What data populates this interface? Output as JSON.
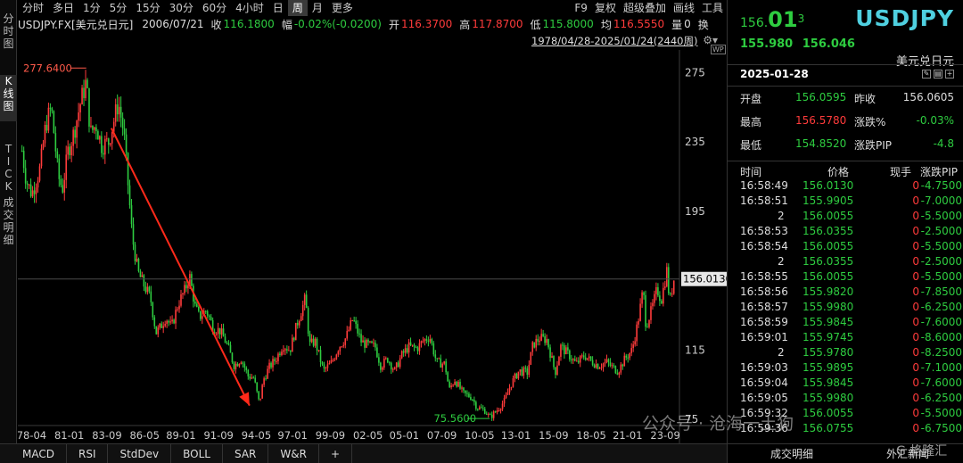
{
  "left_tabs": [
    "分\n时\n图",
    "K\n线\n图",
    "T\nI\nC\nK",
    "成\n交\n明\n细"
  ],
  "toolbar": {
    "periods": [
      "分时",
      "多日",
      "1分",
      "5分",
      "15分",
      "30分",
      "60分",
      "4小时",
      "日",
      "周",
      "月",
      "更多"
    ],
    "active_period": "周",
    "right": [
      "F9",
      "复权",
      "超级叠加",
      "画线",
      "工具"
    ]
  },
  "info": {
    "symbol_label": "USDJPY.FX[美元兑日元]",
    "date": "2006/07/21",
    "close_label": "收",
    "close": "116.1800",
    "range_label": "幅",
    "range": "-0.02%(-0.0200)",
    "open_label": "开",
    "open": "116.3700",
    "high_label": "高",
    "high": "117.8700",
    "low_label": "低",
    "low": "115.8000",
    "avg_label": "均",
    "avg": "116.5550",
    "vol_label": "量",
    "vol": "0",
    "switch_label": "换"
  },
  "range_selector": "1978/04/28-2025/01/24(2440周)",
  "chart_data": {
    "type": "candlestick",
    "title": "",
    "y_ticks": [
      275,
      235,
      195,
      155,
      115,
      75
    ],
    "ylim": [
      72,
      285
    ],
    "x_ticks": [
      "78-04",
      "81-01",
      "83-09",
      "86-05",
      "89-01",
      "91-09",
      "94-05",
      "97-01",
      "99-09",
      "02-05",
      "05-01",
      "07-09",
      "10-05",
      "13-01",
      "15-09",
      "18-05",
      "21-01",
      "23-09"
    ],
    "max_label": "277.6400",
    "min_label": "75.5600",
    "last_price_label": "156.0130",
    "close_path": [
      {
        "x": 1978.3,
        "y": 230
      },
      {
        "x": 1978.6,
        "y": 213
      },
      {
        "x": 1979.0,
        "y": 205
      },
      {
        "x": 1979.6,
        "y": 220
      },
      {
        "x": 1980.0,
        "y": 245
      },
      {
        "x": 1980.4,
        "y": 255
      },
      {
        "x": 1980.9,
        "y": 215
      },
      {
        "x": 1981.2,
        "y": 208
      },
      {
        "x": 1981.6,
        "y": 230
      },
      {
        "x": 1982.0,
        "y": 240
      },
      {
        "x": 1982.5,
        "y": 258
      },
      {
        "x": 1982.9,
        "y": 270
      },
      {
        "x": 1983.2,
        "y": 240
      },
      {
        "x": 1983.6,
        "y": 245
      },
      {
        "x": 1984.0,
        "y": 233
      },
      {
        "x": 1984.5,
        "y": 235
      },
      {
        "x": 1984.9,
        "y": 248
      },
      {
        "x": 1985.2,
        "y": 258
      },
      {
        "x": 1985.6,
        "y": 240
      },
      {
        "x": 1985.9,
        "y": 210
      },
      {
        "x": 1986.2,
        "y": 180
      },
      {
        "x": 1986.6,
        "y": 160
      },
      {
        "x": 1987.0,
        "y": 153
      },
      {
        "x": 1987.5,
        "y": 145
      },
      {
        "x": 1987.9,
        "y": 125
      },
      {
        "x": 1988.2,
        "y": 128
      },
      {
        "x": 1988.6,
        "y": 134
      },
      {
        "x": 1989.0,
        "y": 128
      },
      {
        "x": 1989.5,
        "y": 142
      },
      {
        "x": 1990.0,
        "y": 150
      },
      {
        "x": 1990.3,
        "y": 158
      },
      {
        "x": 1990.7,
        "y": 140
      },
      {
        "x": 1991.0,
        "y": 134
      },
      {
        "x": 1991.5,
        "y": 138
      },
      {
        "x": 1992.0,
        "y": 128
      },
      {
        "x": 1992.5,
        "y": 126
      },
      {
        "x": 1993.0,
        "y": 118
      },
      {
        "x": 1993.5,
        "y": 106
      },
      {
        "x": 1994.0,
        "y": 110
      },
      {
        "x": 1994.5,
        "y": 100
      },
      {
        "x": 1994.9,
        "y": 99
      },
      {
        "x": 1995.3,
        "y": 84
      },
      {
        "x": 1995.6,
        "y": 98
      },
      {
        "x": 1996.0,
        "y": 105
      },
      {
        "x": 1996.5,
        "y": 110
      },
      {
        "x": 1997.0,
        "y": 118
      },
      {
        "x": 1997.5,
        "y": 115
      },
      {
        "x": 1998.0,
        "y": 130
      },
      {
        "x": 1998.6,
        "y": 145
      },
      {
        "x": 1998.9,
        "y": 118
      },
      {
        "x": 1999.3,
        "y": 120
      },
      {
        "x": 1999.9,
        "y": 103
      },
      {
        "x": 2000.5,
        "y": 108
      },
      {
        "x": 2001.0,
        "y": 117
      },
      {
        "x": 2001.5,
        "y": 122
      },
      {
        "x": 2002.0,
        "y": 133
      },
      {
        "x": 2002.6,
        "y": 120
      },
      {
        "x": 2003.0,
        "y": 118
      },
      {
        "x": 2003.6,
        "y": 117
      },
      {
        "x": 2004.0,
        "y": 106
      },
      {
        "x": 2004.5,
        "y": 110
      },
      {
        "x": 2005.0,
        "y": 103
      },
      {
        "x": 2005.5,
        "y": 112
      },
      {
        "x": 2006.0,
        "y": 117
      },
      {
        "x": 2006.6,
        "y": 116
      },
      {
        "x": 2007.0,
        "y": 120
      },
      {
        "x": 2007.5,
        "y": 123
      },
      {
        "x": 2008.0,
        "y": 108
      },
      {
        "x": 2008.6,
        "y": 107
      },
      {
        "x": 2008.9,
        "y": 92
      },
      {
        "x": 2009.3,
        "y": 98
      },
      {
        "x": 2009.9,
        "y": 90
      },
      {
        "x": 2010.5,
        "y": 88
      },
      {
        "x": 2010.9,
        "y": 82
      },
      {
        "x": 2011.5,
        "y": 80
      },
      {
        "x": 2011.8,
        "y": 76
      },
      {
        "x": 2012.3,
        "y": 80
      },
      {
        "x": 2012.9,
        "y": 86
      },
      {
        "x": 2013.3,
        "y": 95
      },
      {
        "x": 2013.9,
        "y": 103
      },
      {
        "x": 2014.5,
        "y": 102
      },
      {
        "x": 2014.9,
        "y": 118
      },
      {
        "x": 2015.4,
        "y": 122
      },
      {
        "x": 2015.9,
        "y": 121
      },
      {
        "x": 2016.5,
        "y": 102
      },
      {
        "x": 2016.9,
        "y": 117
      },
      {
        "x": 2017.5,
        "y": 112
      },
      {
        "x": 2018.0,
        "y": 107
      },
      {
        "x": 2018.6,
        "y": 112
      },
      {
        "x": 2019.0,
        "y": 109
      },
      {
        "x": 2019.6,
        "y": 106
      },
      {
        "x": 2020.2,
        "y": 108
      },
      {
        "x": 2020.6,
        "y": 105
      },
      {
        "x": 2021.0,
        "y": 103
      },
      {
        "x": 2021.5,
        "y": 110
      },
      {
        "x": 2022.0,
        "y": 115
      },
      {
        "x": 2022.4,
        "y": 130
      },
      {
        "x": 2022.8,
        "y": 150
      },
      {
        "x": 2023.0,
        "y": 129
      },
      {
        "x": 2023.4,
        "y": 138
      },
      {
        "x": 2023.8,
        "y": 150
      },
      {
        "x": 2024.1,
        "y": 144
      },
      {
        "x": 2024.5,
        "y": 161
      },
      {
        "x": 2024.7,
        "y": 142
      },
      {
        "x": 2025.0,
        "y": 156
      }
    ],
    "trend_arrow": {
      "from": {
        "x": 1984.7,
        "y": 243
      },
      "to": {
        "x": 1994.6,
        "y": 83
      }
    },
    "colors": {
      "up": "#ff3b3b",
      "down": "#2ecc40",
      "bg": "#000000",
      "axis": "#cccccc",
      "arrow": "#ff2a1a"
    }
  },
  "bottom_tabs": [
    "MACD",
    "RSI",
    "StdDev",
    "BOLL",
    "SAR",
    "W&R",
    "+"
  ],
  "quote_panel": {
    "price_small": "156.",
    "price_big": "01",
    "price_sup": "3",
    "bid": "155.980",
    "ask": "156.046",
    "symbol": "USDJPY",
    "name": "美元兑日元",
    "date": "2025-01-28",
    "stats": [
      {
        "label": "开盘",
        "value": "156.0595",
        "color": "#2ecc40",
        "label2": "昨收",
        "value2": "156.0605",
        "color2": "#dddddd"
      },
      {
        "label": "最高",
        "value": "156.5780",
        "color": "#ff3b3b",
        "label2": "涨跌%",
        "value2": "-0.03%",
        "color2": "#2ecc40"
      },
      {
        "label": "最低",
        "value": "154.8520",
        "color": "#2ecc40",
        "label2": "涨跌PIP",
        "value2": "-4.8",
        "color2": "#2ecc40"
      }
    ],
    "tick_headers": [
      "时间",
      "价格",
      "现手",
      "涨跌PIP"
    ],
    "ticks": [
      {
        "time": "16:58:49",
        "price": "156.0130",
        "vol": "0",
        "pip": "-4.7500"
      },
      {
        "time": "16:58:51",
        "price": "155.9905",
        "vol": "0",
        "pip": "-7.0000"
      },
      {
        "time": "2",
        "price": "156.0055",
        "vol": "0",
        "pip": "-5.5000"
      },
      {
        "time": "16:58:53",
        "price": "156.0355",
        "vol": "0",
        "pip": "-2.5000"
      },
      {
        "time": "16:58:54",
        "price": "156.0055",
        "vol": "0",
        "pip": "-5.5000"
      },
      {
        "time": "2",
        "price": "156.0355",
        "vol": "0",
        "pip": "-2.5000"
      },
      {
        "time": "16:58:55",
        "price": "156.0055",
        "vol": "0",
        "pip": "-5.5000"
      },
      {
        "time": "16:58:56",
        "price": "155.9820",
        "vol": "0",
        "pip": "-7.8500"
      },
      {
        "time": "16:58:57",
        "price": "155.9980",
        "vol": "0",
        "pip": "-6.2500"
      },
      {
        "time": "16:58:59",
        "price": "155.9845",
        "vol": "0",
        "pip": "-7.6000"
      },
      {
        "time": "16:59:01",
        "price": "155.9745",
        "vol": "0",
        "pip": "-8.6000"
      },
      {
        "time": "2",
        "price": "155.9780",
        "vol": "0",
        "pip": "-8.2500"
      },
      {
        "time": "16:59:03",
        "price": "155.9895",
        "vol": "0",
        "pip": "-7.1000"
      },
      {
        "time": "16:59:04",
        "price": "155.9845",
        "vol": "0",
        "pip": "-7.6000"
      },
      {
        "time": "16:59:05",
        "price": "155.9980",
        "vol": "0",
        "pip": "-6.2500"
      },
      {
        "time": "16:59:32",
        "price": "156.0055",
        "vol": "0",
        "pip": "-5.5000"
      },
      {
        "time": "16:59:36",
        "price": "156.0755",
        "vol": "0",
        "pip": "-6.7500"
      }
    ],
    "bottom_tabs": [
      "成交明细",
      "外汇新闻"
    ]
  },
  "watermark": "公众号 · 沧海一土狗",
  "watermark2": "G 格隆汇"
}
